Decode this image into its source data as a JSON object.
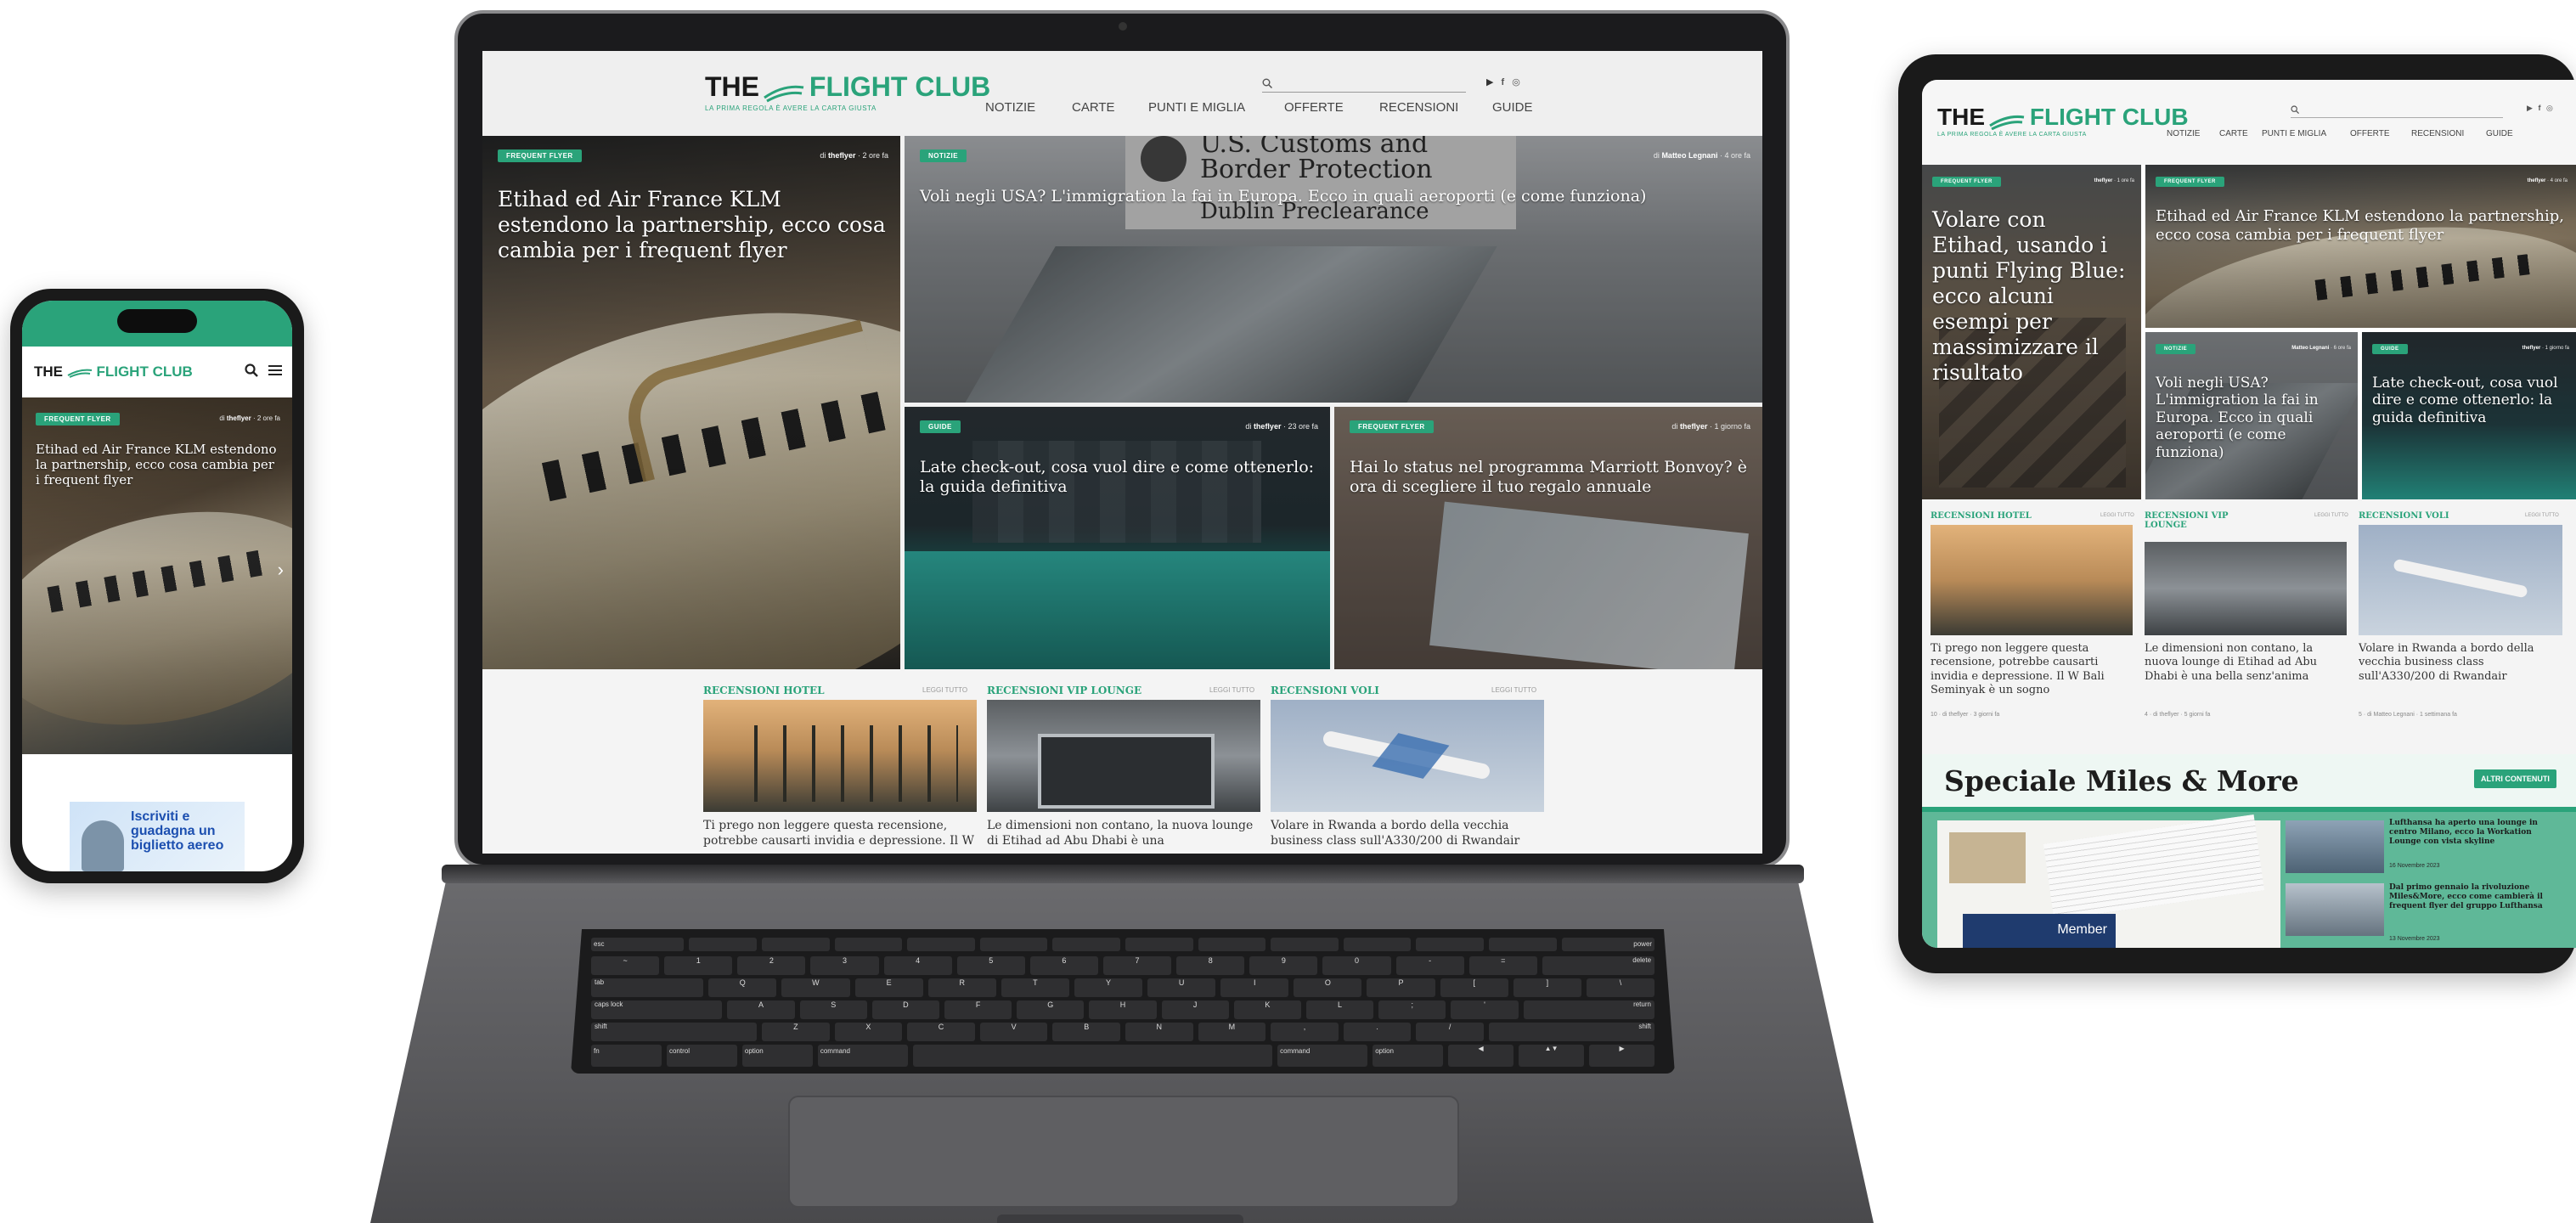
{
  "brand": {
    "name_prefix": "THE",
    "name_main": "FLIGHT CLUB",
    "tagline": "LA PRIMA REGOLA È AVERE LA CARTA GIUSTA",
    "accent": "#2aa37a"
  },
  "nav": [
    "NOTIZIE",
    "CARTE",
    "PUNTI E MIGLIA",
    "OFFERTE",
    "RECENSIONI",
    "GUIDE"
  ],
  "laptop": {
    "hero": {
      "badge": "FREQUENT FLYER",
      "byline_pre": "di",
      "author": "theflyer",
      "time": "· 2 ore fa",
      "title": "Etihad ed Air France KLM estendono la partnership, ecco cosa cambia per i frequent flyer"
    },
    "tile_usa": {
      "badge": "NOTIZIE",
      "byline_pre": "di",
      "author": "Matteo Legnani",
      "time": "· 4 ore fa",
      "title": "Voli negli USA? L'immigration la fai in Europa. Ecco in quali aeroporti (e come funziona)",
      "sign_line1": "U.S. Customs and",
      "sign_line2": "Border Protection",
      "sign_line3": "Dublin Preclearance"
    },
    "tile_checkout": {
      "badge": "GUIDE",
      "byline_pre": "di",
      "author": "theflyer",
      "time": "· 23 ore fa",
      "title": "Late check-out, cosa vuol dire e come ottenerlo: la guida definitiva"
    },
    "tile_marriott": {
      "badge": "FREQUENT FLYER",
      "byline_pre": "di",
      "author": "theflyer",
      "time": "· 1 giorno fa",
      "title": "Hai lo status nel programma Marriott Bonvoy? è ora di scegliere il tuo regalo annuale"
    },
    "reviews": [
      {
        "section": "RECENSIONI HOTEL",
        "leggi": "LEGGI TUTTO",
        "text": "Ti prego non leggere questa recensione, potrebbe causarti invidia e depressione. Il W Bali"
      },
      {
        "section": "RECENSIONI VIP LOUNGE",
        "leggi": "LEGGI TUTTO",
        "text": "Le dimensioni non contano, la nuova lounge di Etihad ad Abu Dhabi è una"
      },
      {
        "section": "RECENSIONI VOLI",
        "leggi": "LEGGI TUTTO",
        "text": "Volare in Rwanda a bordo della vecchia business class sull'A330/200 di Rwandair"
      }
    ]
  },
  "keyboard": {
    "row1": [
      "esc",
      "",
      "",
      "",
      "",
      "",
      "",
      "",
      "",
      "",
      "",
      "",
      "",
      "power"
    ],
    "row2": [
      "~",
      "1",
      "2",
      "3",
      "4",
      "5",
      "6",
      "7",
      "8",
      "9",
      "0",
      "-",
      "=",
      "delete"
    ],
    "row3": [
      "tab",
      "Q",
      "W",
      "E",
      "R",
      "T",
      "Y",
      "U",
      "I",
      "O",
      "P",
      "[",
      "]",
      "\\"
    ],
    "row4": [
      "caps lock",
      "A",
      "S",
      "D",
      "F",
      "G",
      "H",
      "J",
      "K",
      "L",
      ";",
      "'",
      "return"
    ],
    "row5": [
      "shift",
      "Z",
      "X",
      "C",
      "V",
      "B",
      "N",
      "M",
      ",",
      ".",
      "/",
      "shift"
    ],
    "row6": [
      "fn",
      "control",
      "option",
      "command",
      "",
      "command",
      "option",
      "◀",
      "▲▼",
      "▶"
    ]
  },
  "phone": {
    "badge": "FREQUENT FLYER",
    "byline_pre": "di",
    "author": "theflyer",
    "time": "· 2 ore fa",
    "title": "Etihad ed Air France KLM estendono la partnership, ecco cosa cambia per i frequent flyer",
    "promo": "Iscriviti e guadagna un biglietto aereo"
  },
  "tablet": {
    "tile1": {
      "badge": "FREQUENT FLYER",
      "author": "theflyer",
      "time": "· 1 ore fa",
      "title": "Volare con Etihad, usando i punti Flying Blue: ecco alcuni esempi per massimizzare il risultato"
    },
    "tile2": {
      "badge": "FREQUENT FLYER",
      "author": "theflyer",
      "time": "· 4 ore fa",
      "title": "Etihad ed Air France KLM estendono la partnership, ecco cosa cambia per i frequent flyer"
    },
    "tile3": {
      "badge": "NOTIZIE",
      "author": "Matteo Legnani",
      "time": "· 6 ore fa",
      "title": "Voli negli USA? L'immigration la fai in Europa. Ecco in quali aeroporti (e come funziona)"
    },
    "tile4": {
      "badge": "GUIDE",
      "author": "theflyer",
      "time": "· 1 giorno fa",
      "title": "Late check-out, cosa vuol dire e come ottenerlo: la guida definitiva"
    },
    "reviews": [
      {
        "section": "RECENSIONI HOTEL",
        "leggi": "LEGGI TUTTO",
        "text": "Ti prego non leggere questa recensione, potrebbe causarti invidia e depressione. Il W Bali Seminyak è un sogno",
        "meta": "10 · di theflyer · 3 giorni fa"
      },
      {
        "section": "RECENSIONI VIP LOUNGE",
        "leggi": "LEGGI TUTTO",
        "text": "Le dimensioni non contano, la nuova lounge di Etihad ad Abu Dhabi è una bella senz'anima",
        "meta": "4 · di theflyer · 5 giorni fa"
      },
      {
        "section": "RECENSIONI VOLI",
        "leggi": "LEGGI TUTTO",
        "text": "Volare in Rwanda a bordo della vecchia business class sull'A330/200 di Rwandair",
        "meta": "5 · di Matteo Legnani · 1 settimana fa"
      }
    ],
    "speciale": "Speciale Miles & More",
    "altri": "ALTRI CONTENUTI",
    "member": "Member",
    "side_news": [
      {
        "title": "Lufthansa ha aperto una lounge in centro Milano, ecco la Workation Lounge con vista skyline",
        "date": "16 Novembre 2023"
      },
      {
        "title": "Dal primo gennaio la rivoluzione Miles&More, ecco come cambierà il frequent flyer del gruppo Lufthansa",
        "date": "13 Novembre 2023"
      }
    ]
  }
}
